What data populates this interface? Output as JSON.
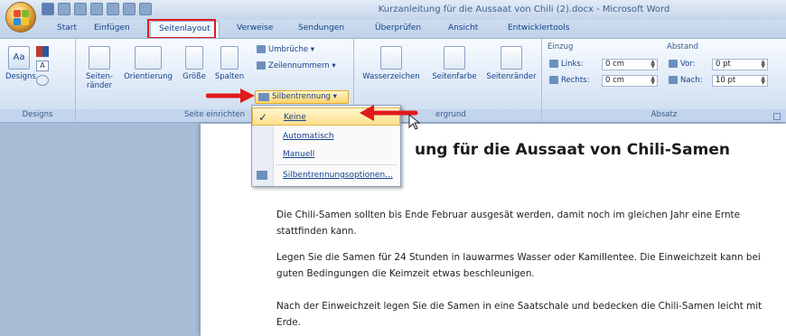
{
  "window": {
    "title": "Kurzanleitung für die Aussaat von Chili (2).docx - Microsoft Word"
  },
  "tabs": [
    "Start",
    "Einfügen",
    "Seitenlayout",
    "Verweise",
    "Sendungen",
    "Überprüfen",
    "Ansicht",
    "Entwicklertools"
  ],
  "active_tab": "Seitenlayout",
  "ribbon": {
    "designs": {
      "button": "Designs",
      "group_label": "Designs"
    },
    "seite_einrichten": {
      "group_label": "Seite einrichten",
      "seitenraender": "Seiten-\nränder",
      "orientierung": "Orientierung",
      "groesse": "Größe",
      "spalten": "Spalten",
      "umbrueche": "Umbrüche",
      "zeilennummern": "Zeilennummern",
      "silbentrennung": "Silbentrennung"
    },
    "seitenhintergrund": {
      "group_label": "Seitenhintergrund",
      "group_label_visible": "ergrund",
      "wasserzeichen": "Wasserzeichen",
      "seitenfarbe": "Seitenfarbe",
      "seitenraender": "Seitenränder"
    },
    "absatz": {
      "group_label": "Absatz",
      "einzug_label": "Einzug",
      "abstand_label": "Abstand",
      "links_label": "Links:",
      "links_value": "0 cm",
      "rechts_label": "Rechts:",
      "rechts_value": "0 cm",
      "vor_label": "Vor:",
      "vor_value": "0 pt",
      "nach_label": "Nach:",
      "nach_value": "10 pt"
    }
  },
  "hyphenation_menu": {
    "items": [
      {
        "label": "Keine",
        "checked": true
      },
      {
        "label": "Automatisch",
        "checked": false
      },
      {
        "label": "Manuell",
        "checked": false
      },
      {
        "label": "Silbentrennungsoptionen...",
        "checked": false
      }
    ]
  },
  "document": {
    "heading_visible": "ung für die Aussaat von Chili-Samen",
    "paragraphs": [
      "Die Chili-Samen sollten bis  Ende Februar ausgesät werden, damit noch im gleichen Jahr eine Ernte stattfinden kann.",
      "Legen Sie die Samen für 24 Stunden in lauwarmes Wasser oder Kamillentee. Die Einweichzeit kann bei guten Bedingungen die Keimzeit etwas beschleunigen.",
      "Nach der Einweichzeit legen Sie die Samen in eine Saatschale und bedecken die Chili-Samen leicht mit Erde."
    ]
  },
  "colors": {
    "highlight_red": "#e01b1b",
    "ribbon_text": "#15428b",
    "menu_selected": "#ffe08a"
  }
}
